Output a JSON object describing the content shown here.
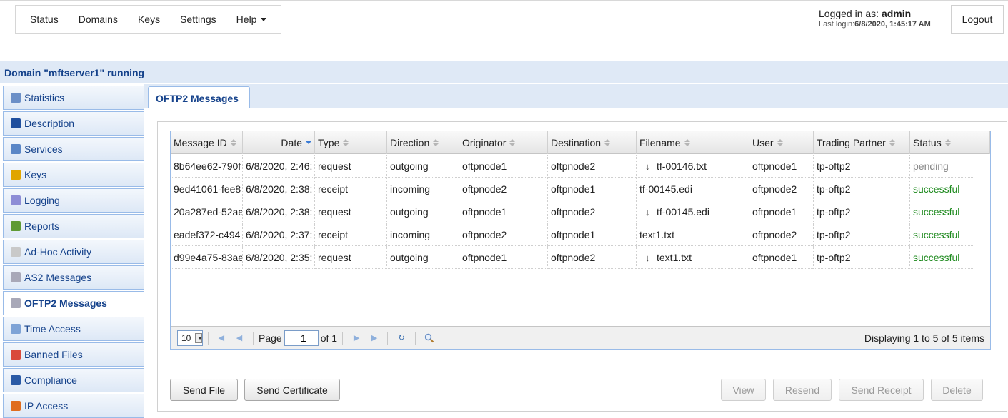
{
  "nav": {
    "menu": [
      {
        "label": "Status"
      },
      {
        "label": "Domains"
      },
      {
        "label": "Keys"
      },
      {
        "label": "Settings"
      },
      {
        "label": "Help"
      }
    ],
    "logged_in_prefix": "Logged in as: ",
    "username": "admin",
    "last_login_prefix": "Last login:",
    "last_login_value": "6/8/2020, 1:45:17 AM",
    "logout_label": "Logout"
  },
  "domain": {
    "header": "Domain \"mftserver1\" running"
  },
  "sidebar": {
    "items": [
      {
        "label": "Statistics",
        "icon": "statistics-icon",
        "color": "#6b8fc7"
      },
      {
        "label": "Description",
        "icon": "user-icon",
        "color": "#1f4f9e"
      },
      {
        "label": "Services",
        "icon": "services-icon",
        "color": "#5a86c6"
      },
      {
        "label": "Keys",
        "icon": "key-icon",
        "color": "#e0a500"
      },
      {
        "label": "Logging",
        "icon": "logging-icon",
        "color": "#8d8dd6"
      },
      {
        "label": "Reports",
        "icon": "reports-icon",
        "color": "#5e9a34"
      },
      {
        "label": "Ad-Hoc Activity",
        "icon": "envelope-icon",
        "color": "#c9c9c9"
      },
      {
        "label": "AS2 Messages",
        "icon": "messages-icon",
        "color": "#a8a8b8"
      },
      {
        "label": "OFTP2 Messages",
        "icon": "messages-icon",
        "color": "#a8a8b8",
        "active": true
      },
      {
        "label": "Time Access",
        "icon": "time-access-icon",
        "color": "#7ea3d6"
      },
      {
        "label": "Banned Files",
        "icon": "banned-files-icon",
        "color": "#d94a3b"
      },
      {
        "label": "Compliance",
        "icon": "compliance-icon",
        "color": "#2a5aa6"
      },
      {
        "label": "IP Access",
        "icon": "ip-access-icon",
        "color": "#e06d1f"
      }
    ]
  },
  "main": {
    "tab_label": "OFTP2 Messages"
  },
  "grid": {
    "columns": [
      {
        "label": "Message ID"
      },
      {
        "label": "Date"
      },
      {
        "label": "Type"
      },
      {
        "label": "Direction"
      },
      {
        "label": "Originator"
      },
      {
        "label": "Destination"
      },
      {
        "label": "Filename"
      },
      {
        "label": "User"
      },
      {
        "label": "Trading Partner"
      },
      {
        "label": "Status"
      }
    ],
    "rows": [
      {
        "id": "8b64ee62-790f",
        "date": "6/8/2020, 2:46:",
        "type": "request",
        "direction": "outgoing",
        "originator": "oftpnode1",
        "destination": "oftpnode2",
        "filename": "tf-00146.txt",
        "download": true,
        "user": "oftpnode1",
        "partner": "tp-oftp2",
        "status": "pending"
      },
      {
        "id": "9ed41061-fee8",
        "date": "6/8/2020, 2:38:",
        "type": "receipt",
        "direction": "incoming",
        "originator": "oftpnode2",
        "destination": "oftpnode1",
        "filename": "tf-00145.edi",
        "download": false,
        "user": "oftpnode2",
        "partner": "tp-oftp2",
        "status": "successful"
      },
      {
        "id": "20a287ed-52ae",
        "date": "6/8/2020, 2:38:",
        "type": "request",
        "direction": "outgoing",
        "originator": "oftpnode1",
        "destination": "oftpnode2",
        "filename": "tf-00145.edi",
        "download": true,
        "user": "oftpnode1",
        "partner": "tp-oftp2",
        "status": "successful"
      },
      {
        "id": "eadef372-c494",
        "date": "6/8/2020, 2:37:",
        "type": "receipt",
        "direction": "incoming",
        "originator": "oftpnode2",
        "destination": "oftpnode1",
        "filename": "text1.txt",
        "download": false,
        "user": "oftpnode2",
        "partner": "tp-oftp2",
        "status": "successful"
      },
      {
        "id": "d99e4a75-83ae",
        "date": "6/8/2020, 2:35:",
        "type": "request",
        "direction": "outgoing",
        "originator": "oftpnode1",
        "destination": "oftpnode2",
        "filename": "text1.txt",
        "download": true,
        "user": "oftpnode1",
        "partner": "tp-oftp2",
        "status": "successful"
      }
    ]
  },
  "pager": {
    "page_size": "10",
    "page_label": "Page",
    "page_value": "1",
    "of_label": "of 1",
    "display_info": "Displaying 1 to 5 of 5 items"
  },
  "actions": {
    "send_file": "Send File",
    "send_certificate": "Send Certificate",
    "view": "View",
    "resend": "Resend",
    "send_receipt": "Send Receipt",
    "delete": "Delete"
  }
}
